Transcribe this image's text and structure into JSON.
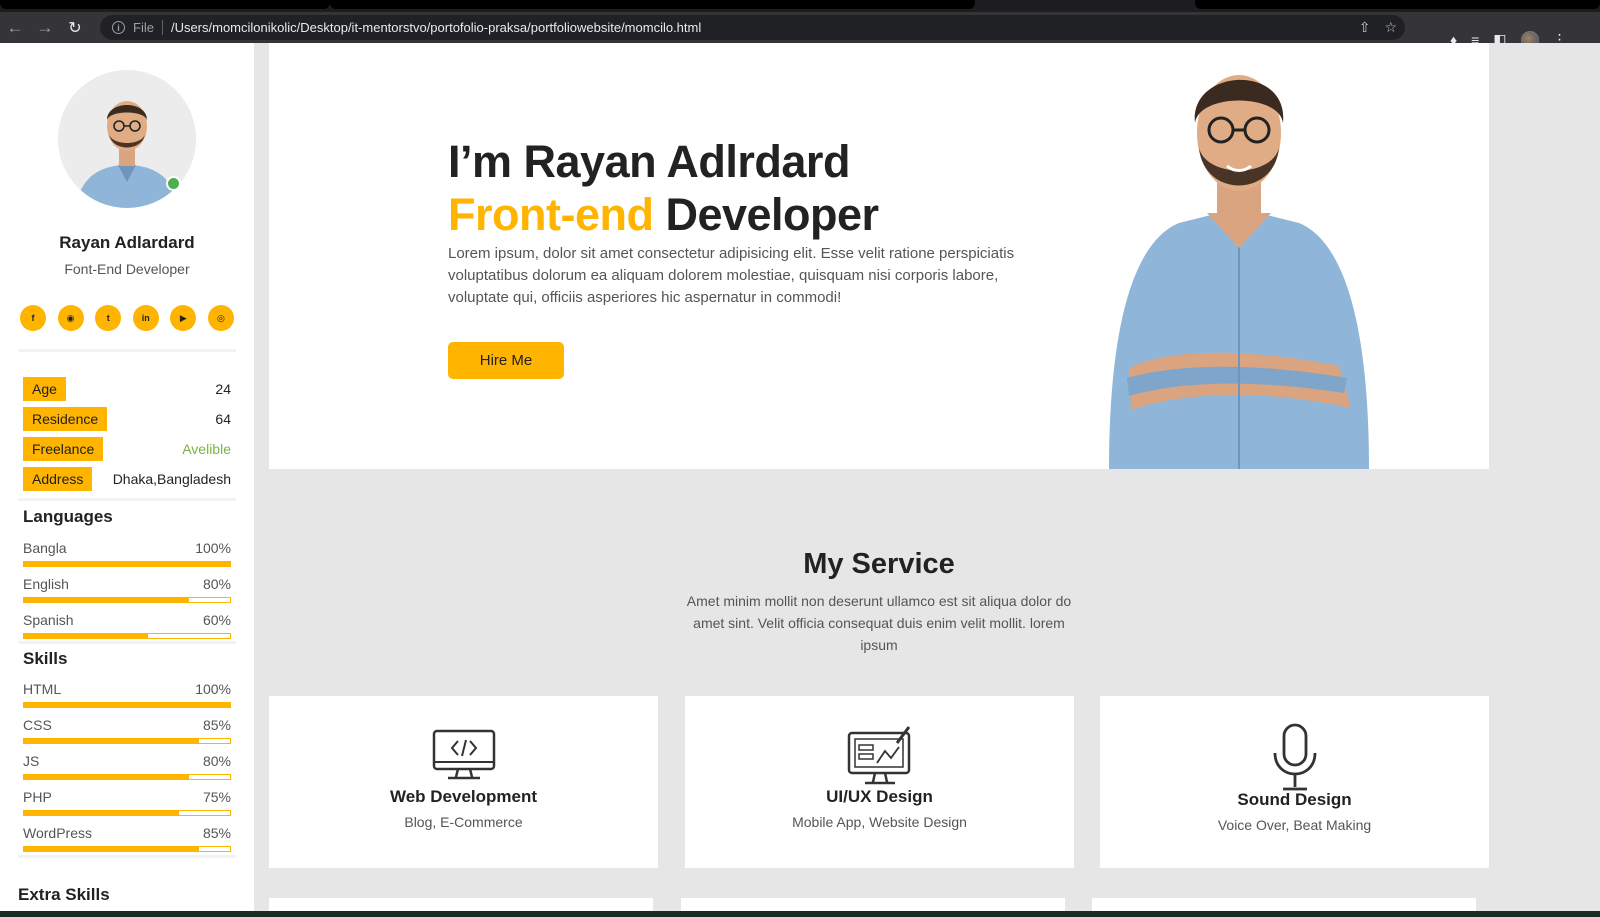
{
  "browser": {
    "scheme": "File",
    "url": "/Users/momcilonikolic/Desktop/it-mentorstvo/portofolio-praksa/portfoliowebsite/momcilo.html",
    "icons": [
      "back-icon",
      "forward-icon",
      "reload-icon",
      "info-icon",
      "share-icon",
      "star-icon",
      "extensions-icon",
      "reading-list-icon",
      "side-panel-icon",
      "profile-avatar",
      "menu-icon"
    ]
  },
  "sidebar": {
    "name": "Rayan Adlardard",
    "role": "Font-End Developer",
    "socials": [
      "facebook-icon",
      "instagram-icon",
      "twitter-icon",
      "linkedin-icon",
      "youtube-icon",
      "dribbble-icon"
    ],
    "info": [
      {
        "key": "Age",
        "value": "24"
      },
      {
        "key": "Residence",
        "value": "64"
      },
      {
        "key": "Freelance",
        "value": "Avelible"
      },
      {
        "key": "Address",
        "value": "Dhaka,Bangladesh"
      }
    ],
    "languages_title": "Languages",
    "languages": [
      {
        "name": "Bangla",
        "percent_label": "100%",
        "value": 100
      },
      {
        "name": "English",
        "percent_label": "80%",
        "value": 80
      },
      {
        "name": "Spanish",
        "percent_label": "60%",
        "value": 60
      }
    ],
    "skills_title": "Skills",
    "skills": [
      {
        "name": "HTML",
        "percent_label": "100%",
        "value": 100
      },
      {
        "name": "CSS",
        "percent_label": "85%",
        "value": 85
      },
      {
        "name": "JS",
        "percent_label": "80%",
        "value": 80
      },
      {
        "name": "PHP",
        "percent_label": "75%",
        "value": 75
      },
      {
        "name": "WordPress",
        "percent_label": "85%",
        "value": 85
      }
    ],
    "extra_title": "Extra Skills"
  },
  "hero": {
    "line1": "I’m Rayan Adlrdard",
    "line2_accent": "Front-end",
    "line2_rest": " Developer",
    "description": "Lorem ipsum, dolor sit amet consectetur adipisicing elit. Esse velit ratione perspiciatis voluptatibus dolorum ea aliquam dolorem molestiae, quisquam nisi corporis labore, voluptate qui, officiis asperiores hic aspernatur in commodi!",
    "button": "Hire Me"
  },
  "services": {
    "title": "My Service",
    "description": "Amet minim mollit non deserunt ullamco est sit aliqua dolor do amet sint. Velit officia consequat duis enim velit mollit. lorem ipsum",
    "cards": [
      {
        "title": "Web Development",
        "subtitle": "Blog, E-Commerce",
        "icon": "monitor-code-icon"
      },
      {
        "title": "UI/UX Design",
        "subtitle": "Mobile App, Website Design",
        "icon": "design-monitor-icon"
      },
      {
        "title": "Sound Design",
        "subtitle": "Voice Over, Beat Making",
        "icon": "microphone-icon"
      }
    ]
  },
  "colors": {
    "accent": "#ffb400",
    "text": "#222222",
    "muted": "#555555",
    "page_bg": "#e6e6e6",
    "green": "#7cb342"
  }
}
